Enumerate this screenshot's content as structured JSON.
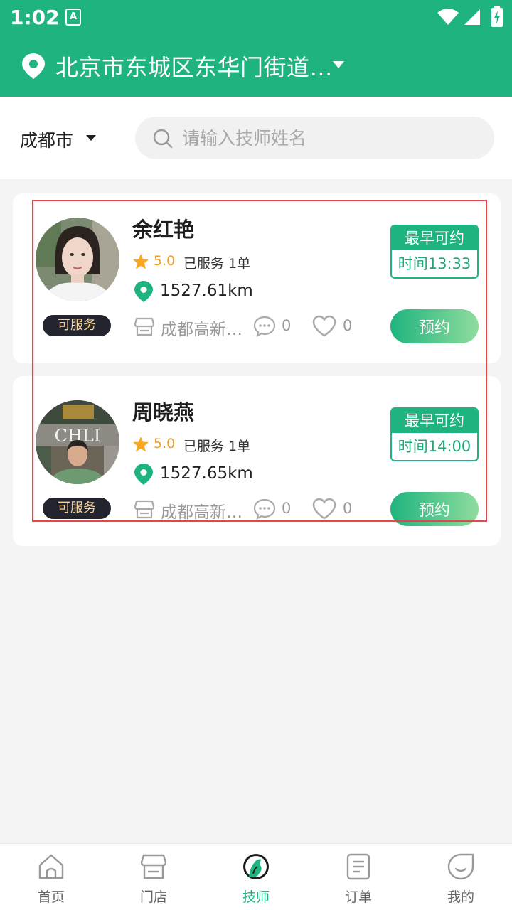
{
  "status_bar": {
    "time": "1:02",
    "notification_icon": "a-icon",
    "wifi_icon": "wifi-icon",
    "signal_icon": "signal-icon",
    "battery_icon": "battery-charging-icon"
  },
  "header": {
    "location": "北京市东城区东华门街道…"
  },
  "filter": {
    "city": "成都市",
    "search_placeholder": "请输入技师姓名"
  },
  "technicians": [
    {
      "name": "余红艳",
      "rating": "5.0",
      "served": "已服务 1单",
      "distance": "1527.61km",
      "shop": "成都高新…",
      "comments": "0",
      "likes": "0",
      "status": "可服务",
      "earliest_label": "最早可约",
      "earliest_time": "时间13:33",
      "book_label": "预约"
    },
    {
      "name": "周晓燕",
      "rating": "5.0",
      "served": "已服务 1单",
      "distance": "1527.65km",
      "shop": "成都高新…",
      "comments": "0",
      "likes": "0",
      "status": "可服务",
      "earliest_label": "最早可约",
      "earliest_time": "时间14:00",
      "book_label": "预约"
    }
  ],
  "tabs": [
    {
      "label": "首页",
      "icon": "home-icon"
    },
    {
      "label": "门店",
      "icon": "store-icon"
    },
    {
      "label": "技师",
      "icon": "technician-icon",
      "active": true
    },
    {
      "label": "订单",
      "icon": "order-icon"
    },
    {
      "label": "我的",
      "icon": "profile-icon"
    }
  ],
  "colors": {
    "primary": "#1fb47f",
    "badge_bg": "#23252e",
    "rating": "#f59a23",
    "highlight": "#e04848"
  }
}
